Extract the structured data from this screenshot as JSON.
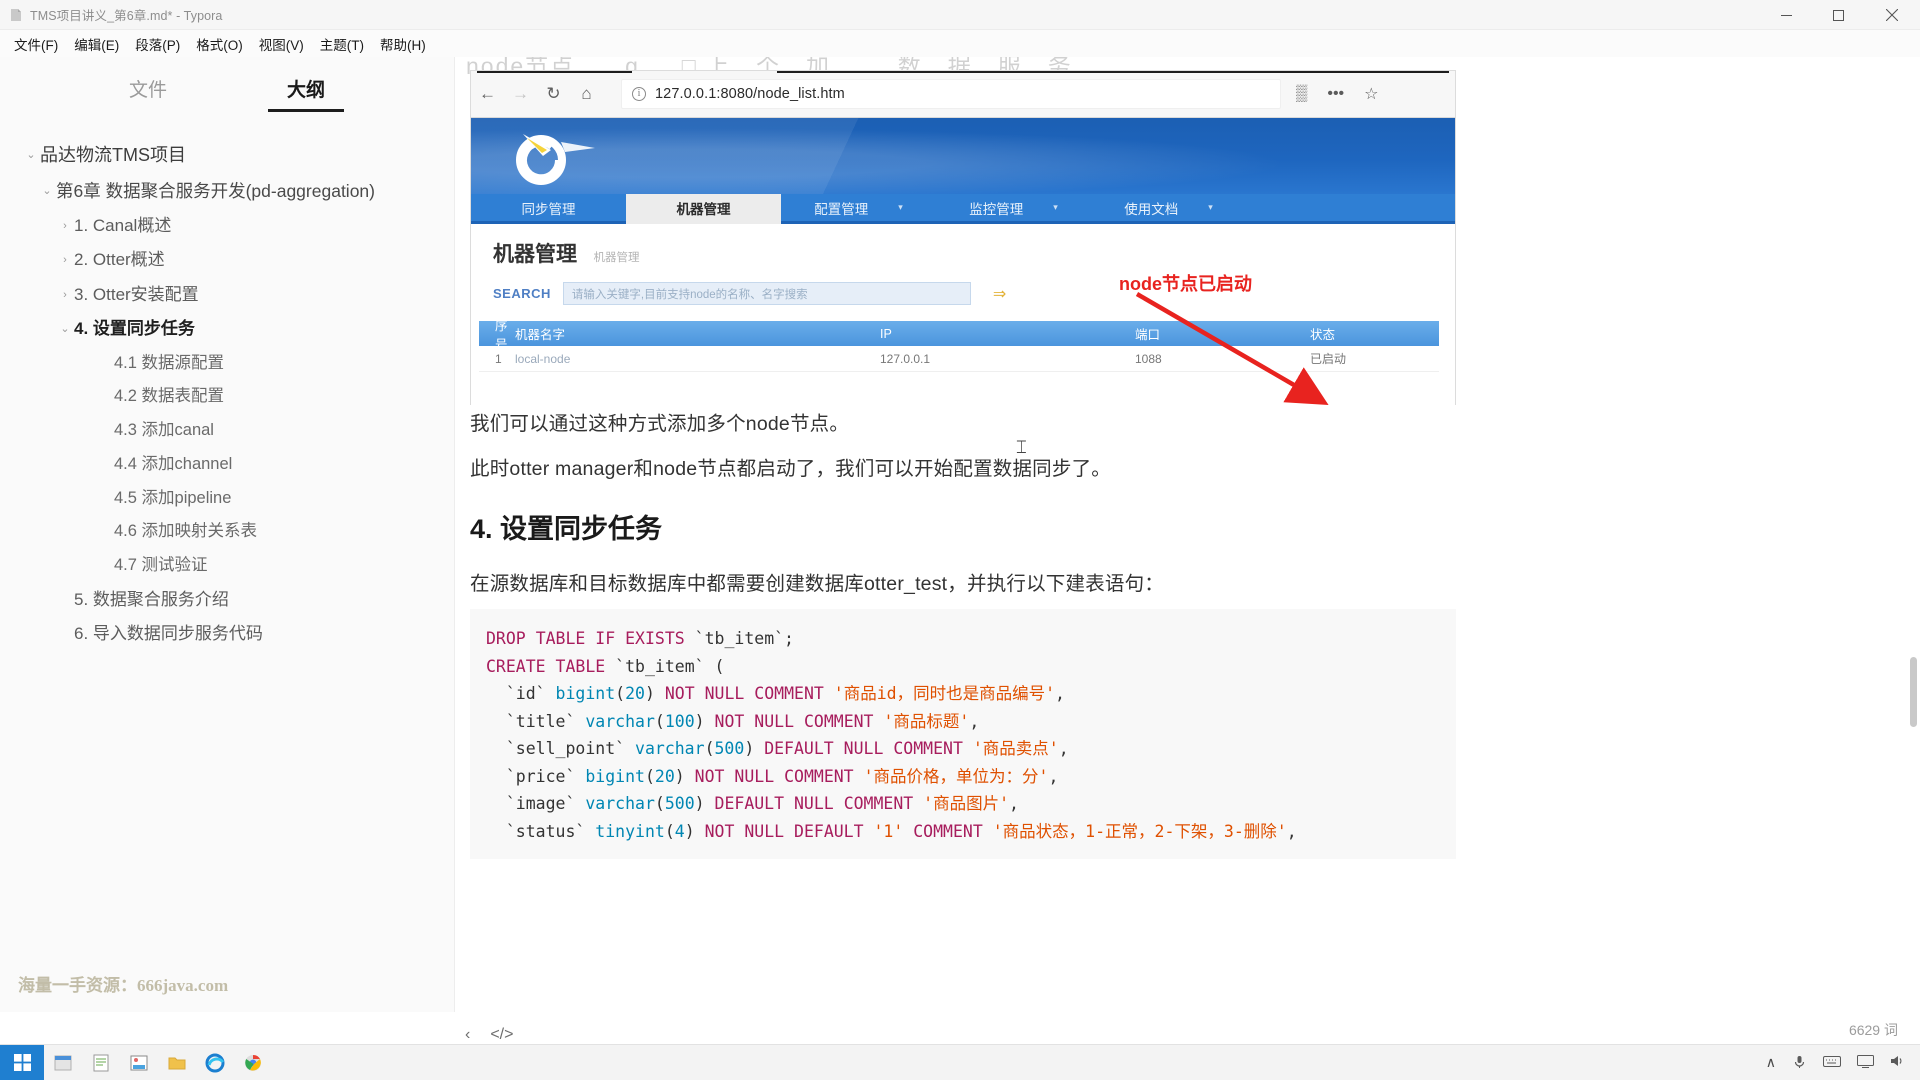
{
  "window": {
    "title": "TMS项目讲义_第6章.md* - Typora",
    "minimize": "—",
    "maximize": "□",
    "close": "✕"
  },
  "menu": [
    {
      "label": "文件(F)"
    },
    {
      "label": "编辑(E)"
    },
    {
      "label": "段落(P)"
    },
    {
      "label": "格式(O)"
    },
    {
      "label": "视图(V)"
    },
    {
      "label": "主题(T)"
    },
    {
      "label": "帮助(H)"
    }
  ],
  "sidebar": {
    "tabs": [
      {
        "label": "文件",
        "active": false
      },
      {
        "label": "大纲",
        "active": true
      }
    ],
    "outline": [
      {
        "label": "品达物流TMS项目",
        "level": 1,
        "arrow": "v"
      },
      {
        "label": "第6章 数据聚合服务开发(pd-aggregation)",
        "level": 2,
        "arrow": "v"
      },
      {
        "label": "1. Canal概述",
        "level": 3,
        "arrow": ">"
      },
      {
        "label": "2. Otter概述",
        "level": 3,
        "arrow": ">"
      },
      {
        "label": "3. Otter安装配置",
        "level": 3,
        "arrow": ">"
      },
      {
        "label": "4. 设置同步任务",
        "level": 3,
        "arrow": "v",
        "bold": true
      },
      {
        "label": "4.1 数据源配置",
        "level": 4,
        "arrow": ""
      },
      {
        "label": "4.2 数据表配置",
        "level": 4,
        "arrow": ""
      },
      {
        "label": "4.3 添加canal",
        "level": 4,
        "arrow": ""
      },
      {
        "label": "4.4 添加channel",
        "level": 4,
        "arrow": ""
      },
      {
        "label": "4.5 添加pipeline",
        "level": 4,
        "arrow": ""
      },
      {
        "label": "4.6 添加映射关系表",
        "level": 4,
        "arrow": ""
      },
      {
        "label": "4.7 测试验证",
        "level": 4,
        "arrow": ""
      },
      {
        "label": "5. 数据聚合服务介绍",
        "level": 3,
        "arrow": ""
      },
      {
        "label": "6. 导入数据同步服务代码",
        "level": 3,
        "arrow": ""
      }
    ],
    "watermark": "海量一手资源：666java.com"
  },
  "screenshot": {
    "browser": {
      "back": "←",
      "forward": "→",
      "reload": "↻",
      "home": "⌂",
      "url": "127.0.0.1:8080/node_list.htm",
      "info_icon": "i",
      "reader_icon": "▒",
      "menu_icon": "•••",
      "star_icon": "☆"
    },
    "nav_tabs": [
      {
        "label": "同步管理",
        "active": false,
        "caret": ""
      },
      {
        "label": "机器管理",
        "active": true,
        "caret": ""
      },
      {
        "label": "配置管理",
        "active": false,
        "caret": "▾"
      },
      {
        "label": "监控管理",
        "active": false,
        "caret": "▾"
      },
      {
        "label": "使用文档",
        "active": false,
        "caret": "▾"
      }
    ],
    "panel": {
      "title": "机器管理",
      "subtitle": "机器管理",
      "search_label": "SEARCH",
      "search_placeholder": "请输入关键字,目前支持node的名称、名字搜索",
      "search_go": "⇒"
    },
    "table": {
      "headers": [
        "序号",
        "机器名字",
        "IP",
        "端口",
        "状态"
      ],
      "rows": [
        [
          "1",
          "local-node",
          "127.0.0.1",
          "1088",
          "已启动"
        ]
      ]
    },
    "annotation": "node节点已启动",
    "annotation_color": "#e8231f"
  },
  "document": {
    "paragraph1": "我们可以通过这种方式添加多个node节点。",
    "paragraph2": "此时otter manager和node节点都启动了，我们可以开始配置数据同步了。",
    "heading4": "4. 设置同步任务",
    "paragraph3": "在源数据库和目标数据库中都需要创建数据库otter_test，并执行以下建表语句：",
    "code_lines": [
      "DROP TABLE IF EXISTS `tb_item`;",
      "CREATE TABLE `tb_item` (",
      "  `id` bigint(20) NOT NULL COMMENT '商品id，同时也是商品编号',",
      "  `title` varchar(100) NOT NULL COMMENT '商品标题',",
      "  `sell_point` varchar(500) DEFAULT NULL COMMENT '商品卖点',",
      "  `price` bigint(20) NOT NULL COMMENT '商品价格，单位为：分',",
      "  `image` varchar(500) DEFAULT NULL COMMENT '商品图片',",
      "  `status` tinyint(4) NOT NULL DEFAULT '1' COMMENT '商品状态，1-正常，2-下架，3-删除',"
    ]
  },
  "statusbar": {
    "outline_toggle": "‹",
    "source_toggle": "</>",
    "word_count": "6629 词"
  },
  "taskbar": {
    "start": "⊞",
    "apps": [
      "file-explorer-icon",
      "notepad-icon",
      "paint-icon",
      "folder-icon",
      "edge-icon",
      "chrome-icon"
    ],
    "tray": [
      "∧",
      "🎤",
      "⌨",
      "🖵",
      "🔊"
    ]
  }
}
